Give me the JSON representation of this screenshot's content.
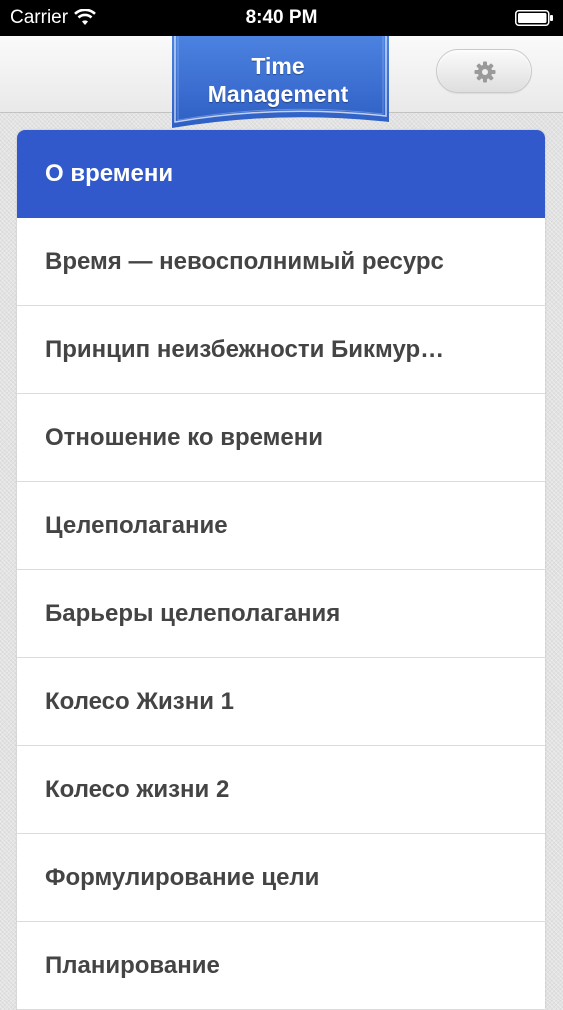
{
  "status_bar": {
    "carrier": "Carrier",
    "time": "8:40 PM",
    "icons": [
      "wifi-icon",
      "battery-icon"
    ]
  },
  "header": {
    "banner_line1": "Time",
    "banner_line2": "Management",
    "settings_icon": "gear-icon"
  },
  "colors": {
    "accent": "#3159cb",
    "item_text": "#444444",
    "banner_blue": "#3a6fd2"
  },
  "list": {
    "items": [
      {
        "label": "О времени",
        "selected": true
      },
      {
        "label": "Время — невосполнимый ресурс"
      },
      {
        "label": "Принцип неизбежности Бикмур…"
      },
      {
        "label": "Отношение ко времени"
      },
      {
        "label": "Целеполагание"
      },
      {
        "label": "Барьеры целеполагания"
      },
      {
        "label": "Колесо Жизни 1"
      },
      {
        "label": "Колесо жизни 2"
      },
      {
        "label": "Формулирование цели"
      },
      {
        "label": "Планирование"
      }
    ]
  }
}
